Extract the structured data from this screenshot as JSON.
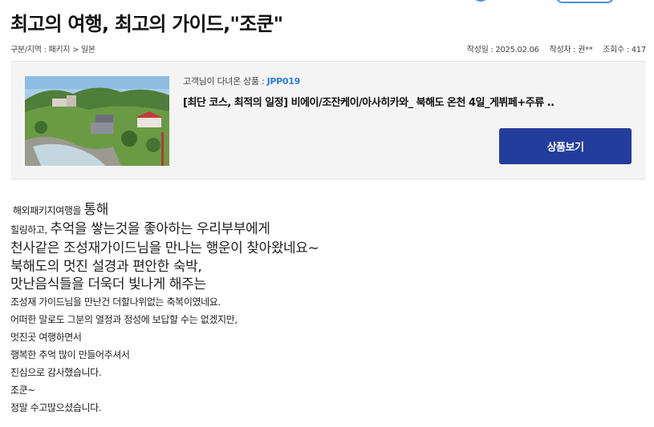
{
  "review": {
    "title": "최고의 여행, 최고의 가이드,\"조쿤\"",
    "meta": {
      "category": "구분/지역 : 패키지 > 일본",
      "date": "작성일 : 2025.02.06",
      "author": "작성자 : 권**",
      "views": "조회수 : 417"
    },
    "product": {
      "visited_prefix": "고객님이 다녀온 상품 : ",
      "code": "JPP019",
      "name": "[최단 코스, 최적의 일정] 비에이/조잔케이/아사히카와_ 북해도 온천 4일_게뷔페+주류 ..",
      "button_label": "상품보기"
    },
    "body": {
      "l0_small": "해외패키지여행을 ",
      "l0_large": "통해",
      "l1_small": "힐링하고, ",
      "l1_large": "추억을 쌓는것을 좋아하는 우리부부에게",
      "l2": "천사같은 조성재가이드님을 만나는 행운이 찾아왔네요~",
      "l3": "북해도의 멋진 설경과 편안한 숙박,",
      "l4": "맛난음식들을 더욱더 빛나게 해주는",
      "p1": "조성재 가이드님을 만난건 더할나위없는 축복이였네요.",
      "p2": "어떠한 말로도 그분의 열정과 정성에 보답할 수는 없겠지만,",
      "p3": "멋진곳 여행하면서",
      "p4": "행복한 추억 많이 만들어주셔서",
      "p5": "진심으로 감사했습니다.",
      "p6": "조쿤~",
      "p7": "정말 수고많으셨습니다."
    }
  }
}
